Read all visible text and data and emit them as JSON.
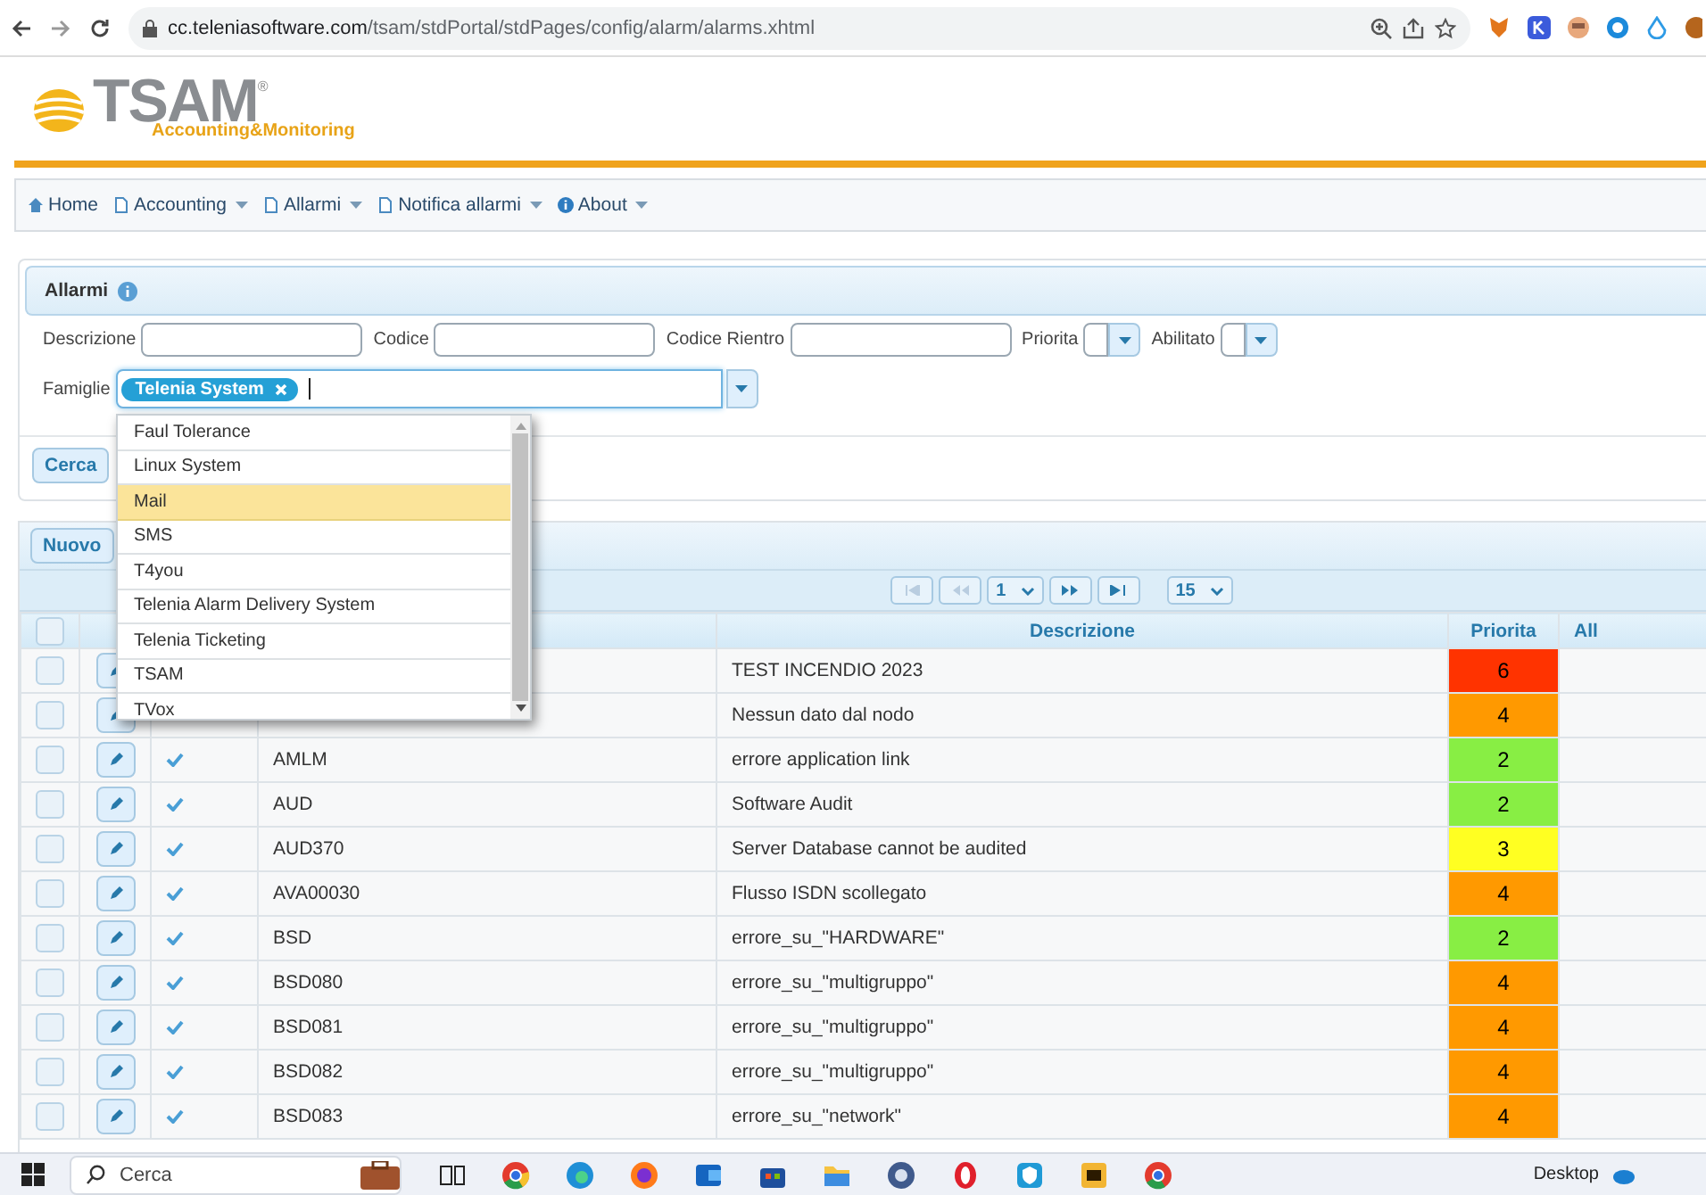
{
  "browser": {
    "url_host": "cc.teleniasoftware.com",
    "url_path": "/tsam/stdPortal/stdPages/config/alarm/alarms.xhtml"
  },
  "logo": {
    "name": "TSAM",
    "mark": "®",
    "tagline": "Accounting&Monitoring"
  },
  "menu": [
    {
      "label": "Home",
      "kind": "home",
      "dropdown": false
    },
    {
      "label": "Accounting",
      "kind": "page",
      "dropdown": true
    },
    {
      "label": "Allarmi",
      "kind": "page",
      "dropdown": true
    },
    {
      "label": "Notifica allarmi",
      "kind": "page",
      "dropdown": true
    },
    {
      "label": "About",
      "kind": "info",
      "dropdown": true
    }
  ],
  "filter_panel": {
    "title": "Allarmi",
    "fields": [
      {
        "label": "Descrizione",
        "kind": "text"
      },
      {
        "label": "Codice",
        "kind": "text"
      },
      {
        "label": "Codice Rientro",
        "kind": "text"
      },
      {
        "label": "Priorita",
        "kind": "select"
      },
      {
        "label": "Abilitato",
        "kind": "select"
      }
    ],
    "families": {
      "label": "Famiglie",
      "chips": [
        "Telenia System"
      ]
    },
    "search_button": "Cerca"
  },
  "family_options": [
    {
      "label": "Faul Tolerance",
      "selected": false
    },
    {
      "label": "Linux System",
      "selected": false
    },
    {
      "label": "Mail",
      "selected": true
    },
    {
      "label": "SMS",
      "selected": false
    },
    {
      "label": "T4you",
      "selected": false
    },
    {
      "label": "Telenia Alarm Delivery System",
      "selected": false
    },
    {
      "label": "Telenia Ticketing",
      "selected": false
    },
    {
      "label": "TSAM",
      "selected": false
    },
    {
      "label": "TVox",
      "selected": false
    }
  ],
  "toolbar": {
    "new_button": "Nuovo"
  },
  "paginator": {
    "page": "1",
    "rows_per_page": "15"
  },
  "table": {
    "select_all": {
      "checked": false
    },
    "columns": [
      "Descrizione",
      "Priorita",
      "All"
    ],
    "rows": [
      {
        "checked": false,
        "description": "TEST INCENDIO 2023",
        "priority": "6",
        "color": "#ff3300"
      },
      {
        "checked": false,
        "description": "Nessun dato dal nodo",
        "priority": "4",
        "color": "#ff9900"
      },
      {
        "checked": false,
        "enabled": true,
        "code": "AMLM",
        "description": "errore application link",
        "priority": "2",
        "color": "#88ee44"
      },
      {
        "checked": false,
        "enabled": true,
        "code": "AUD",
        "description": "Software Audit",
        "priority": "2",
        "color": "#88ee44"
      },
      {
        "checked": false,
        "enabled": true,
        "code": "AUD370",
        "description": "Server Database cannot be audited",
        "priority": "3",
        "color": "#ffff22"
      },
      {
        "checked": false,
        "enabled": true,
        "code": "AVA00030",
        "description": "Flusso ISDN scollegato",
        "priority": "4",
        "color": "#ff9900"
      },
      {
        "checked": false,
        "enabled": true,
        "code": "BSD",
        "description": "errore_su_\"HARDWARE\"",
        "priority": "2",
        "color": "#88ee44"
      },
      {
        "checked": false,
        "enabled": true,
        "code": "BSD080",
        "description": "errore_su_\"multigruppo\"",
        "priority": "4",
        "color": "#ff9900"
      },
      {
        "checked": false,
        "enabled": true,
        "code": "BSD081",
        "description": "errore_su_\"multigruppo\"",
        "priority": "4",
        "color": "#ff9900"
      },
      {
        "checked": false,
        "enabled": true,
        "code": "BSD082",
        "description": "errore_su_\"multigruppo\"",
        "priority": "4",
        "color": "#ff9900"
      },
      {
        "checked": false,
        "enabled": true,
        "code": "BSD083",
        "description": "errore_su_\"network\"",
        "priority": "4",
        "color": "#ff9900"
      }
    ]
  },
  "taskbar": {
    "search_placeholder": "Cerca",
    "desktop_label": "Desktop"
  }
}
